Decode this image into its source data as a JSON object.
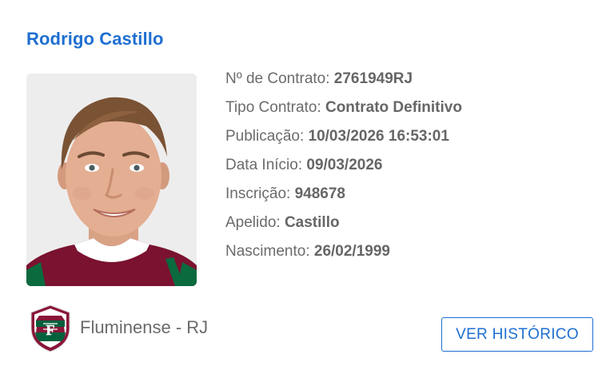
{
  "player": {
    "name": "Rodrigo Castillo",
    "photo_icon": "player-portrait"
  },
  "details": [
    {
      "label": "Nº de Contrato: ",
      "value": "2761949RJ"
    },
    {
      "label": "Tipo Contrato: ",
      "value": "Contrato Definitivo"
    },
    {
      "label": "Publicação: ",
      "value": "10/03/2026 16:53:01"
    },
    {
      "label": "Data Início: ",
      "value": "09/03/2026"
    },
    {
      "label": "Inscrição: ",
      "value": "948678"
    },
    {
      "label": "Apelido: ",
      "value": "Castillo"
    },
    {
      "label": "Nascimento: ",
      "value": "26/02/1999"
    }
  ],
  "club": {
    "name": "Fluminense - RJ",
    "crest_icon": "fluminense-crest",
    "colors": {
      "primary": "#8a1538",
      "secondary": "#00613c",
      "accent": "#ffffff"
    }
  },
  "actions": {
    "history_label": "VER HISTÓRICO"
  },
  "theme": {
    "accent": "#1f6fd1",
    "text": "#6b6b6b"
  }
}
